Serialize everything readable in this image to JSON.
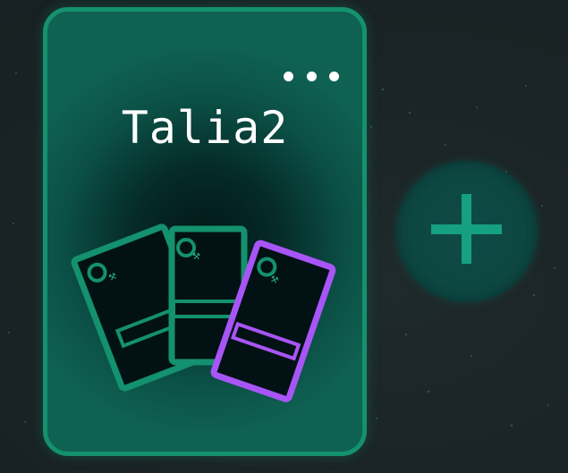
{
  "deck": {
    "name": "Talia2",
    "cards": [
      {
        "border_color": "#14916f"
      },
      {
        "border_color": "#14916f"
      },
      {
        "border_color": "#a855f7"
      }
    ]
  },
  "menu": {
    "icon": "more-horizontal-icon"
  },
  "add": {
    "icon": "plus-icon"
  },
  "colors": {
    "accent": "#14916f",
    "purple": "#a855f7",
    "text": "#ffffff",
    "background": "#1b2426"
  }
}
